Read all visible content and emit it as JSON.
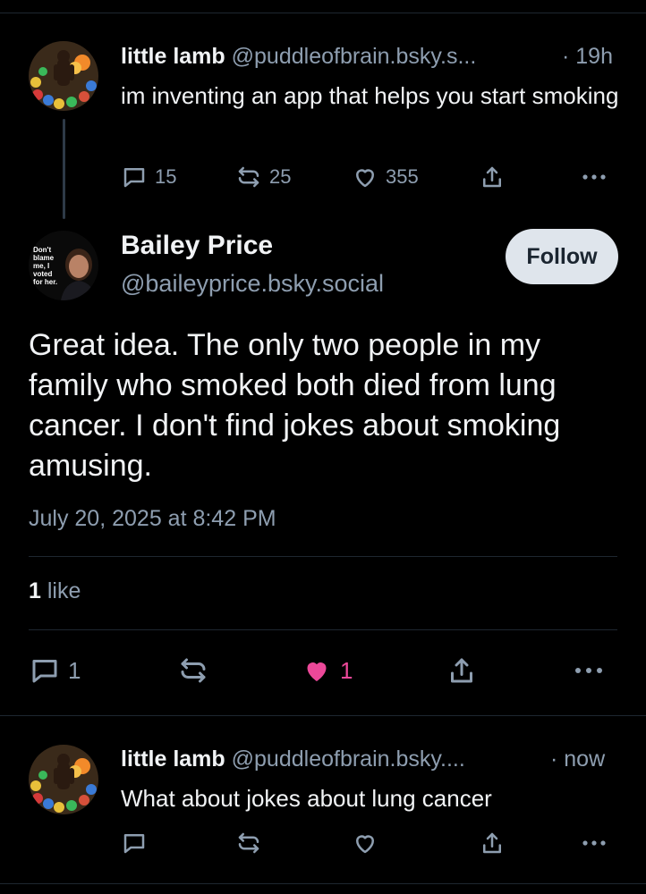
{
  "parent_post": {
    "name": "little lamb",
    "handle": "@puddleofbrain.bsky.s...",
    "time": "· 19h",
    "text": "im inventing an app that helps you start smoking",
    "replies": "15",
    "reposts": "25",
    "likes": "355"
  },
  "main_post": {
    "name": "Bailey Price",
    "handle": "@baileyprice.bsky.social",
    "follow_label": "Follow",
    "avatar_caption": "Don't blame me, I voted for her.",
    "text": "Great idea. The only two people in my family who smoked both died from lung cancer. I don't find jokes about smoking amusing.",
    "timestamp": "July 20, 2025 at 8:42 PM",
    "likes_count": "1",
    "likes_label": "like",
    "replies": "1",
    "like_count": "1",
    "like_color": "#ec4899"
  },
  "reply_post": {
    "name": "little lamb",
    "handle": "@puddleofbrain.bsky....",
    "time": "· now",
    "text": "What about jokes about lung cancer"
  },
  "colors": {
    "background": "#000000",
    "text": "#f1f3f5",
    "muted": "#8e9eb0",
    "divider": "#1e2730"
  }
}
